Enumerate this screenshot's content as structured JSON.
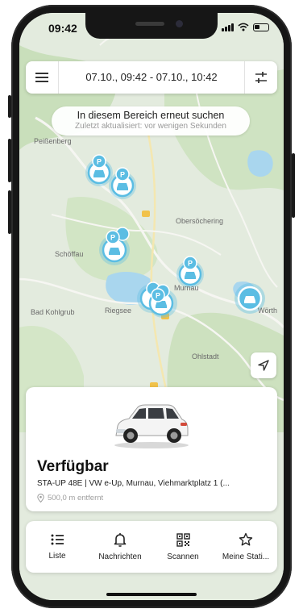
{
  "status_bar": {
    "time": "09:42"
  },
  "topbar": {
    "date_range": "07.10., 09:42 - 07.10., 10:42"
  },
  "search_pill": {
    "title": "In diesem Bereich erneut suchen",
    "subtitle": "Zuletzt aktualisiert: vor wenigen Sekunden"
  },
  "map": {
    "places": [
      "Peißenberg",
      "Obersöchering",
      "Schöffau",
      "Murnau",
      "Bad Kohlgrub",
      "Ohlstadt",
      "Riegsee",
      "Wörth"
    ],
    "marker_symbol": "P"
  },
  "vehicle_card": {
    "status": "Verfügbar",
    "details": "STA-UP 48E | VW e-Up, Murnau, Viehmarktplatz 1 (...",
    "distance": "500,0 m entfernt"
  },
  "tabbar": {
    "tabs": [
      {
        "label": "Liste",
        "icon": "list-icon"
      },
      {
        "label": "Nachrichten",
        "icon": "bell-icon"
      },
      {
        "label": "Scannen",
        "icon": "qr-code-icon"
      },
      {
        "label": "Meine Stati...",
        "icon": "star-icon"
      }
    ]
  },
  "colors": {
    "marker": "#5bbde3",
    "map_background": "#e3ebde",
    "water": "#a9d6ee",
    "forest": "#c6deb8"
  }
}
